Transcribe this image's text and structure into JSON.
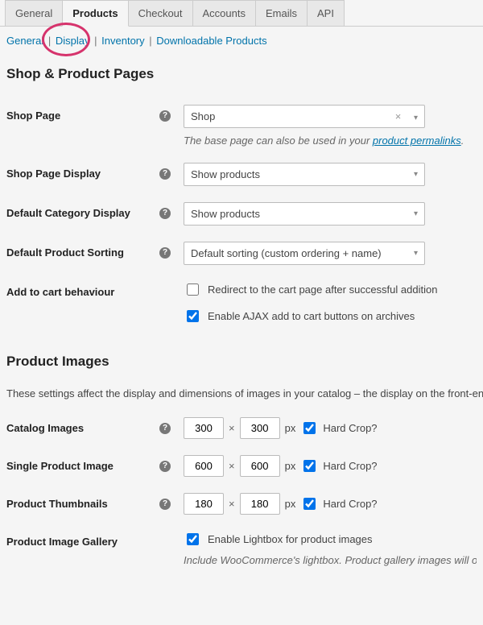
{
  "tabs": {
    "general": "General",
    "products": "Products",
    "checkout": "Checkout",
    "accounts": "Accounts",
    "emails": "Emails",
    "api": "API"
  },
  "subnav": {
    "general": "General",
    "display": "Display",
    "inventory": "Inventory",
    "downloadable": "Downloadable Products"
  },
  "sections": {
    "shop_pages": "Shop & Product Pages",
    "product_images": "Product Images"
  },
  "shop_page": {
    "label": "Shop Page",
    "value": "Shop",
    "desc_prefix": "The base page can also be used in your ",
    "desc_link": "product permalinks",
    "desc_suffix": "."
  },
  "shop_page_display": {
    "label": "Shop Page Display",
    "value": "Show products"
  },
  "default_category_display": {
    "label": "Default Category Display",
    "value": "Show products"
  },
  "default_product_sorting": {
    "label": "Default Product Sorting",
    "value": "Default sorting (custom ordering + name)"
  },
  "add_to_cart": {
    "label": "Add to cart behaviour",
    "redirect": "Redirect to the cart page after successful addition",
    "ajax": "Enable AJAX add to cart buttons on archives"
  },
  "images_note": "These settings affect the display and dimensions of images in your catalog – the display on the front-end will",
  "catalog_images": {
    "label": "Catalog Images",
    "w": "300",
    "h": "300",
    "px": "px",
    "crop": "Hard Crop?"
  },
  "single_product_image": {
    "label": "Single Product Image",
    "w": "600",
    "h": "600",
    "px": "px",
    "crop": "Hard Crop?"
  },
  "product_thumbnails": {
    "label": "Product Thumbnails",
    "w": "180",
    "h": "180",
    "px": "px",
    "crop": "Hard Crop?"
  },
  "gallery": {
    "label": "Product Image Gallery",
    "lightbox": "Enable Lightbox for product images",
    "desc": "Include WooCommerce's lightbox. Product gallery images will op"
  },
  "glyph": {
    "times": "×",
    "caret": "▾",
    "sep": "|"
  }
}
